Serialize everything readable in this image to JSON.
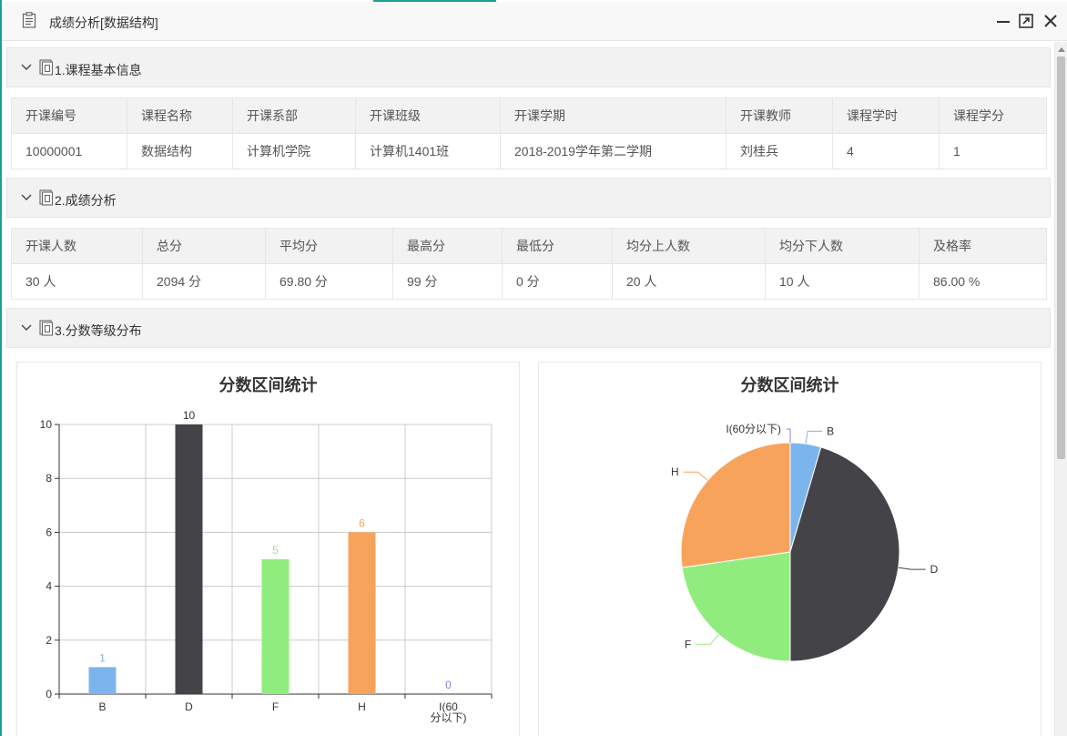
{
  "window": {
    "title": "成绩分析[数据结构]",
    "minimize_icon": "minimize-icon",
    "maximize_icon": "maximize-icon",
    "close_icon": "close-icon"
  },
  "sections": [
    {
      "title": "1.课程基本信息",
      "icon": "document-icon"
    },
    {
      "title": "2.成绩分析",
      "icon": "document-icon"
    },
    {
      "title": "3.分数等级分布",
      "icon": "document-icon"
    }
  ],
  "course_table": {
    "headers": [
      "开课编号",
      "课程名称",
      "开课系部",
      "开课班级",
      "开课学期",
      "开课教师",
      "课程学时",
      "课程学分"
    ],
    "row": [
      "10000001",
      "数据结构",
      "计算机学院",
      "计算机1401班",
      "2018-2019学年第二学期",
      "刘桂兵",
      "4",
      "1"
    ]
  },
  "score_table": {
    "headers": [
      "开课人数",
      "总分",
      "平均分",
      "最高分",
      "最低分",
      "均分上人数",
      "均分下人数",
      "及格率"
    ],
    "row": [
      "30 人",
      "2094 分",
      "69.80 分",
      "99 分",
      "0 分",
      "20 人",
      "10 人",
      "86.00 %"
    ]
  },
  "chart_data": [
    {
      "type": "bar",
      "title": "分数区间统计",
      "categories": [
        "B",
        "D",
        "F",
        "H",
        "I(60分以下)"
      ],
      "values": [
        1,
        10,
        5,
        6,
        0
      ],
      "colors": [
        "#7cb5ec",
        "#434348",
        "#90ed7d",
        "#f7a35c",
        "#8085e9"
      ],
      "ylim": [
        0,
        10
      ],
      "yticks": [
        0,
        2,
        4,
        6,
        8,
        10
      ],
      "grid": true
    },
    {
      "type": "pie",
      "title": "分数区间统计",
      "labels": [
        "B",
        "D",
        "F",
        "H",
        "I(60分以下)"
      ],
      "values": [
        1,
        10,
        5,
        6,
        0
      ],
      "colors": [
        "#7cb5ec",
        "#434348",
        "#90ed7d",
        "#f7a35c",
        "#8085e9"
      ]
    }
  ]
}
